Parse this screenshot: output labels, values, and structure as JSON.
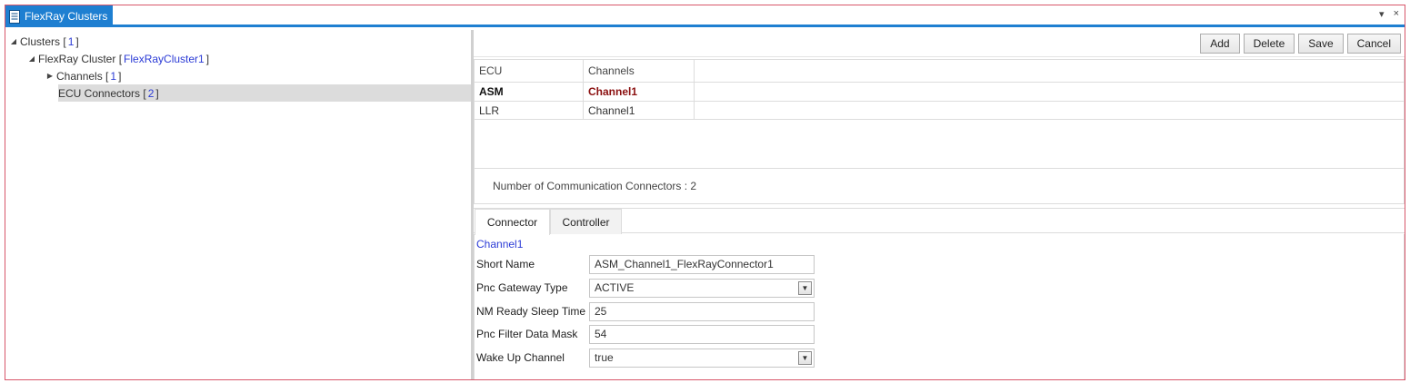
{
  "window": {
    "title": "FlexRay Clusters",
    "controls": {
      "menu_glyph": "▾",
      "close_glyph": "×"
    }
  },
  "tree": {
    "clusters": {
      "label": "Clusters [",
      "count": "1",
      "close": "]"
    },
    "cluster": {
      "label": "FlexRay Cluster [",
      "name": "FlexRayCluster1",
      "close": "]"
    },
    "channels": {
      "label": "Channels [",
      "count": "1",
      "close": "]"
    },
    "ecu_connectors": {
      "label": "ECU Connectors [",
      "count": "2",
      "close": "]"
    }
  },
  "toolbar": {
    "add_label": "Add",
    "delete_label": "Delete",
    "save_label": "Save",
    "cancel_label": "Cancel"
  },
  "grid": {
    "columns": [
      "ECU",
      "Channels"
    ],
    "rows": [
      {
        "ecu": "ASM",
        "channel": "Channel1"
      },
      {
        "ecu": "LLR",
        "channel": "Channel1"
      }
    ]
  },
  "summary": {
    "text": "Number of Communication Connectors : 2"
  },
  "tabs": [
    {
      "label": "Connector",
      "active": true
    },
    {
      "label": "Controller",
      "active": false
    }
  ],
  "form": {
    "header": "Channel1",
    "fields": [
      {
        "label": "Short Name",
        "value": "ASM_Channel1_FlexRayConnector1",
        "type": "text"
      },
      {
        "label": "Pnc Gateway Type",
        "value": "ACTIVE",
        "type": "select"
      },
      {
        "label": "NM Ready Sleep Time",
        "value": "25",
        "type": "text"
      },
      {
        "label": "Pnc Filter Data Mask",
        "value": "54",
        "type": "text"
      },
      {
        "label": "Wake Up Channel",
        "value": "true",
        "type": "select"
      }
    ]
  },
  "colors": {
    "accent": "#1e7fd1",
    "frame_border": "#d8566a",
    "link": "#2b3bd6",
    "selected_row": "#dcdcdc",
    "highlight_text": "#8b1010"
  }
}
